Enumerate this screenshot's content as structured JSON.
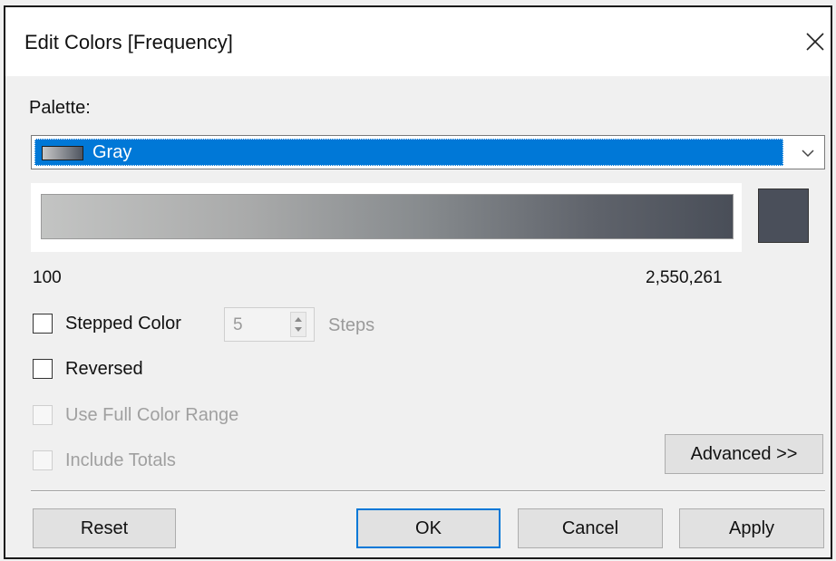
{
  "dialog": {
    "title": "Edit Colors [Frequency]",
    "close_icon": "close-icon"
  },
  "palette": {
    "label": "Palette:",
    "selected": "Gray",
    "dropdown_icon": "chevron-down-icon"
  },
  "gradient": {
    "start_color": "#c3c4c3",
    "end_color": "#4a4f5a",
    "min_label": "100",
    "max_label": "2,550,261"
  },
  "options": {
    "stepped_color": {
      "label": "Stepped Color",
      "checked": false,
      "enabled": true
    },
    "steps": {
      "value": "5",
      "unit_label": "Steps",
      "enabled": false
    },
    "reversed": {
      "label": "Reversed",
      "checked": false,
      "enabled": true
    },
    "use_full_color_range": {
      "label": "Use Full Color Range",
      "checked": false,
      "enabled": false
    },
    "include_totals": {
      "label": "Include Totals",
      "checked": false,
      "enabled": false
    }
  },
  "buttons": {
    "advanced": "Advanced >>",
    "reset": "Reset",
    "ok": "OK",
    "cancel": "Cancel",
    "apply": "Apply"
  },
  "colors": {
    "accent": "#0078d7",
    "dialog_background": "#f0f0f0",
    "title_background": "#ffffff"
  }
}
